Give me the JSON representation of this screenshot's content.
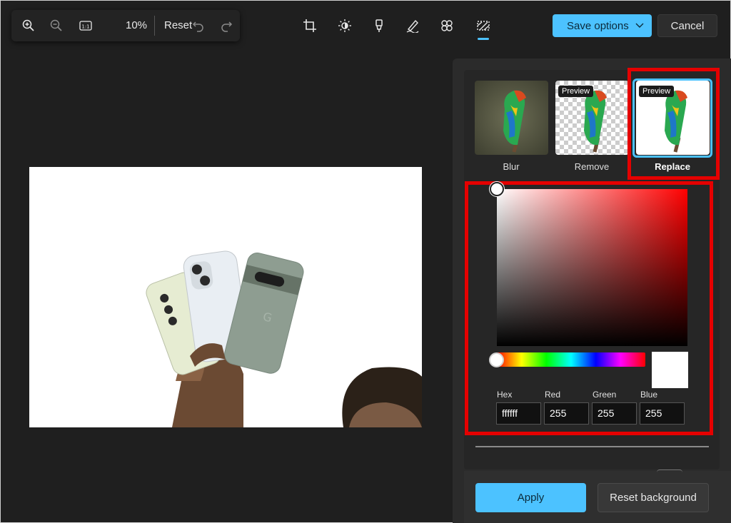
{
  "toolbar": {
    "zoom_in_icon": "zoom-in-icon",
    "zoom_out_icon": "zoom-out-icon",
    "actual_size_label": "1:1",
    "zoom_level": "10%",
    "reset_label": "Reset",
    "undo_icon": "undo-icon",
    "redo_icon": "redo-icon"
  },
  "tools": [
    "crop-icon",
    "brightness-icon",
    "markup-icon",
    "draw-icon",
    "effects-icon",
    "background-icon"
  ],
  "actions": {
    "save_label": "Save options",
    "cancel_label": "Cancel"
  },
  "background_modes": [
    {
      "label": "Blur",
      "preview": ""
    },
    {
      "label": "Remove",
      "preview": "Preview"
    },
    {
      "label": "Replace",
      "preview": "Preview",
      "selected": true
    }
  ],
  "color_picker": {
    "hex_label": "Hex",
    "red_label": "Red",
    "green_label": "Green",
    "blue_label": "Blue",
    "hex_value": "ffffff",
    "red_value": "255",
    "green_value": "255",
    "blue_value": "255",
    "hue_color": "#ff0000",
    "selected_color": "#ffffff"
  },
  "footer": {
    "apply_label": "Apply",
    "reset_background_label": "Reset background"
  },
  "colors": {
    "accent": "#4cc2ff",
    "highlight": "#e50000",
    "panel": "#2b2b2b"
  }
}
